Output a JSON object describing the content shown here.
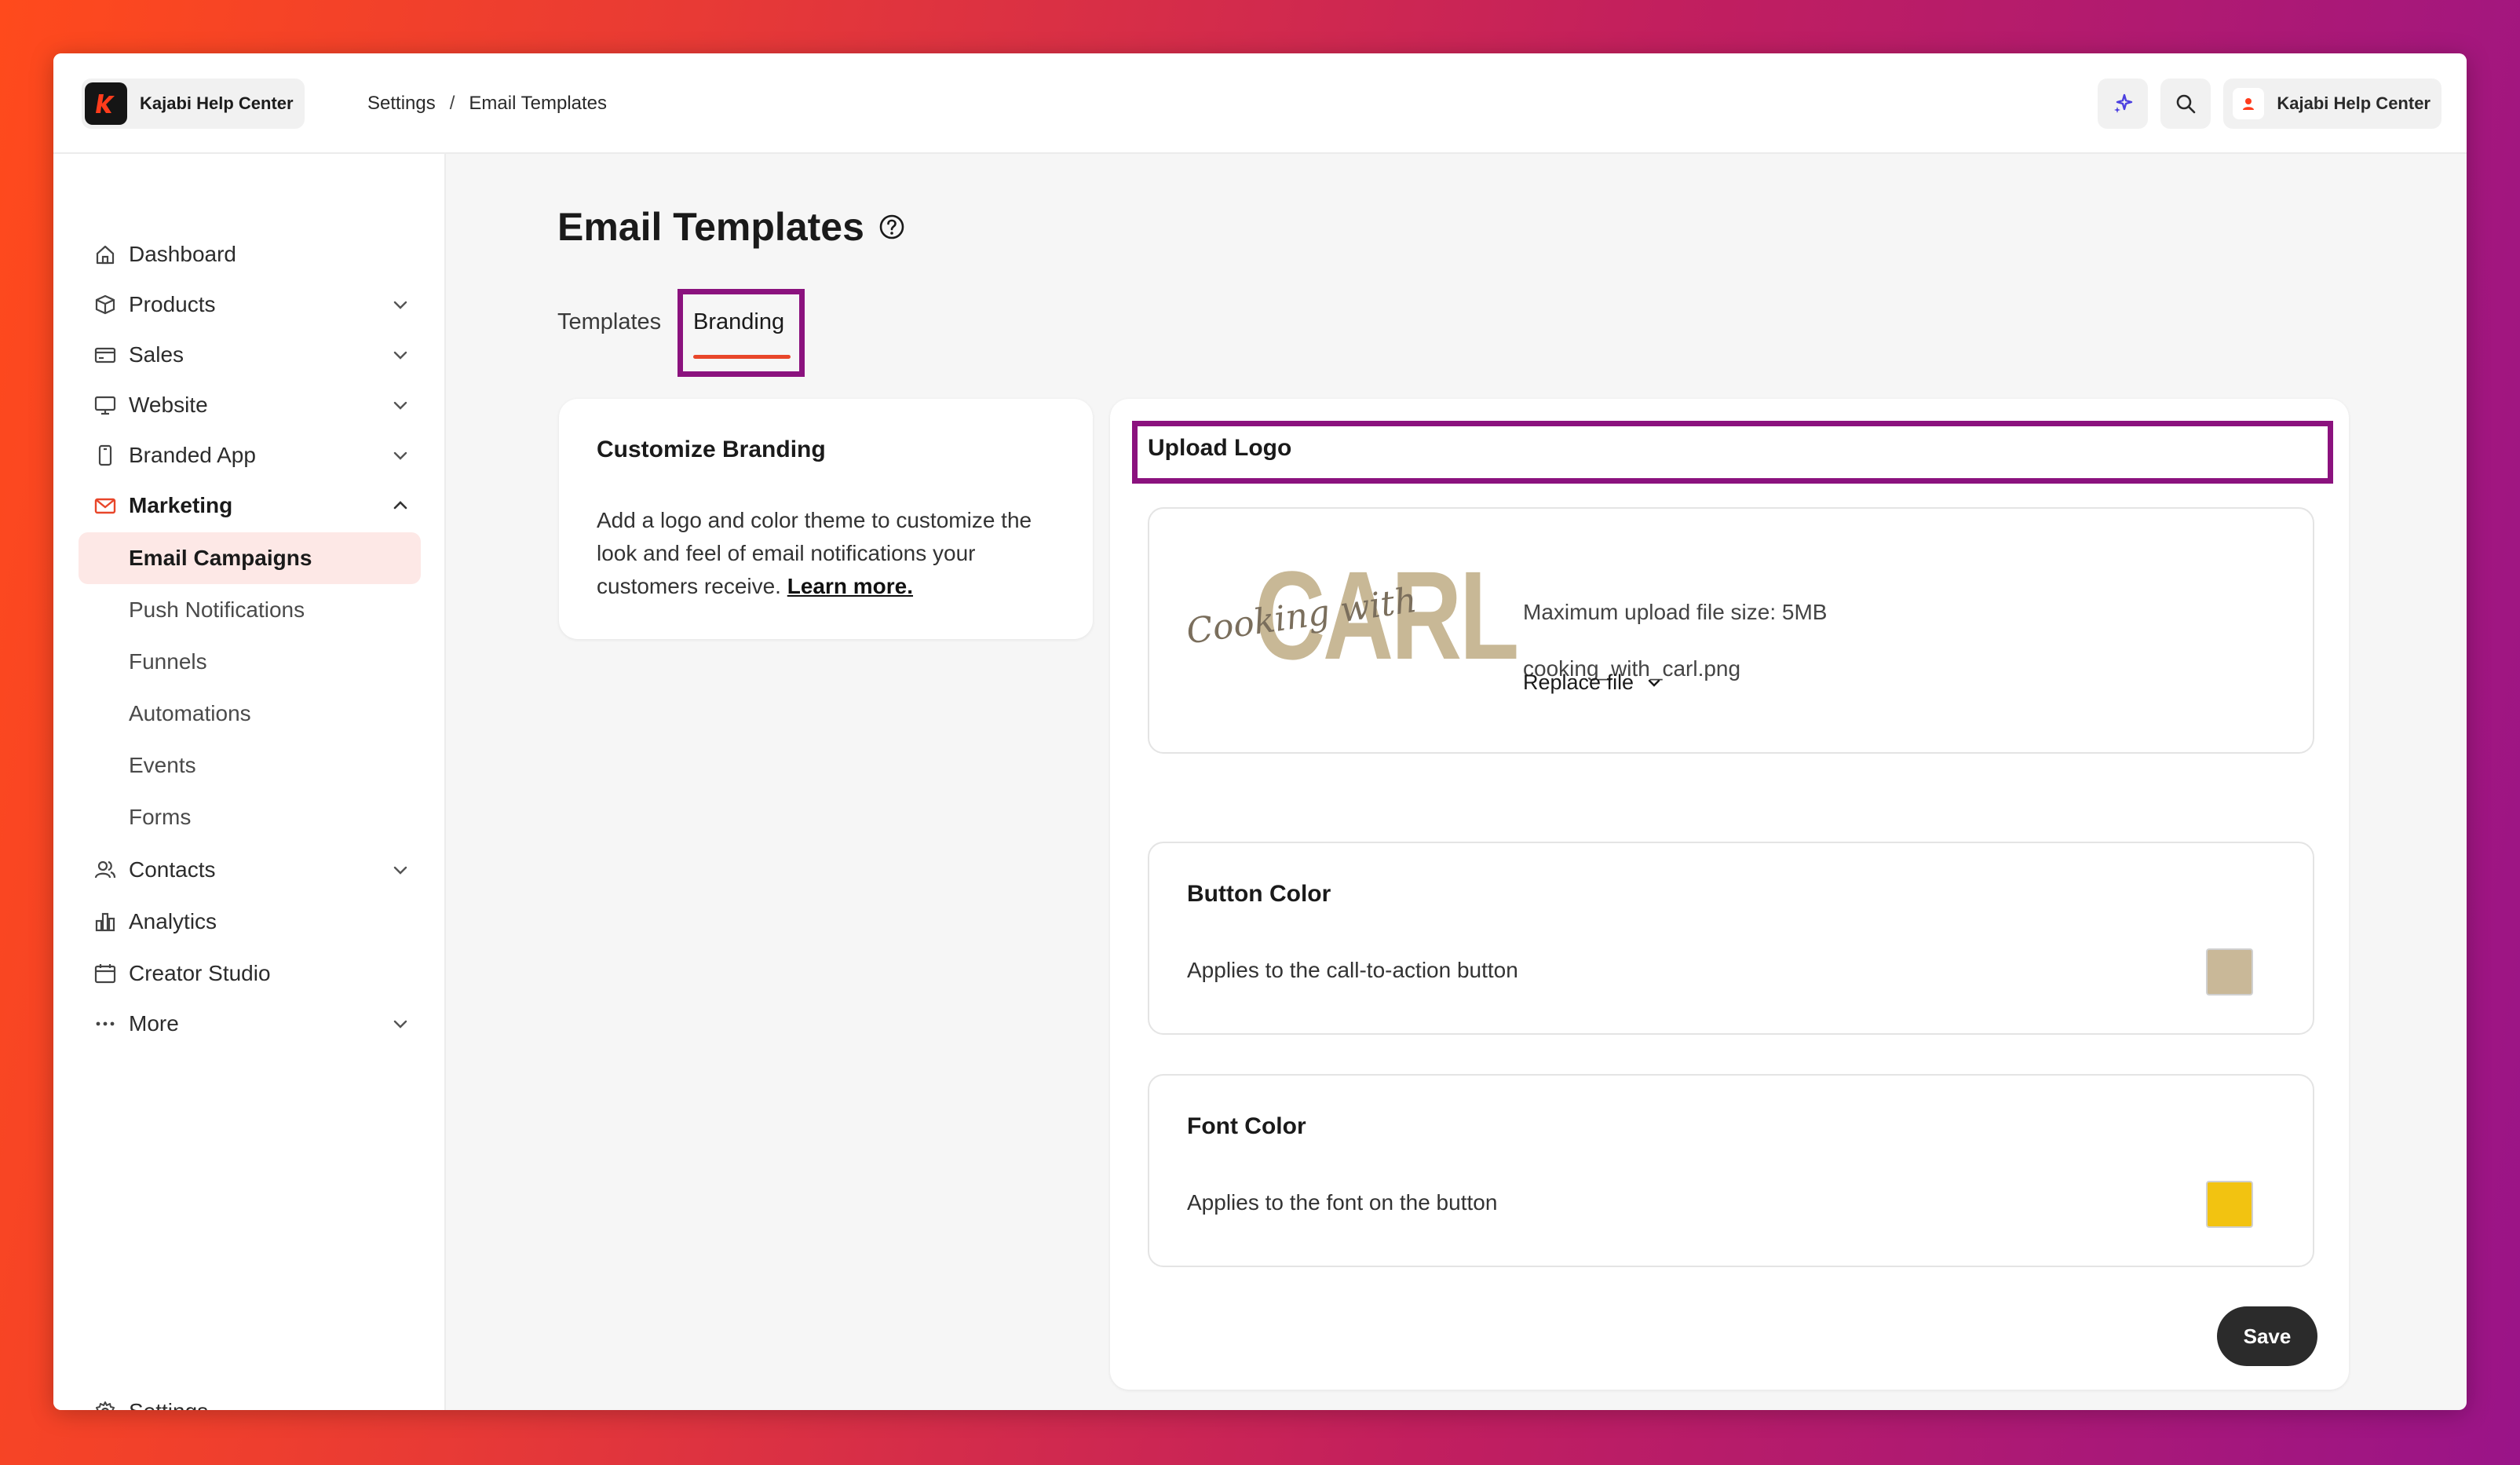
{
  "app": {
    "brand_name": "Kajabi Help Center",
    "user_label": "Kajabi Help Center"
  },
  "breadcrumb": {
    "parent": "Settings",
    "separator": "/",
    "current": "Email Templates"
  },
  "sidebar": {
    "items": [
      {
        "label": "Dashboard",
        "icon": "home-icon",
        "has_chevron": false
      },
      {
        "label": "Products",
        "icon": "box-icon",
        "has_chevron": true
      },
      {
        "label": "Sales",
        "icon": "credit-card-icon",
        "has_chevron": true
      },
      {
        "label": "Website",
        "icon": "monitor-icon",
        "has_chevron": true
      },
      {
        "label": "Branded App",
        "icon": "mobile-icon",
        "has_chevron": true
      },
      {
        "label": "Marketing",
        "icon": "mail-icon",
        "has_chevron": true,
        "expanded": true
      },
      {
        "label": "Contacts",
        "icon": "users-icon",
        "has_chevron": true
      },
      {
        "label": "Analytics",
        "icon": "bar-chart-icon",
        "has_chevron": false
      },
      {
        "label": "Creator Studio",
        "icon": "calendar-icon",
        "has_chevron": false
      },
      {
        "label": "More",
        "icon": "dots-icon",
        "has_chevron": true
      }
    ],
    "marketing_sub": [
      {
        "label": "Email Campaigns",
        "selected": true
      },
      {
        "label": "Push Notifications"
      },
      {
        "label": "Funnels"
      },
      {
        "label": "Automations"
      },
      {
        "label": "Events"
      },
      {
        "label": "Forms"
      }
    ],
    "settings_label": "Settings"
  },
  "main": {
    "title": "Email Templates",
    "tabs": [
      {
        "label": "Templates",
        "active": false
      },
      {
        "label": "Branding",
        "active": true
      }
    ],
    "customize": {
      "title": "Customize Branding",
      "description": "Add a logo and color theme to customize the look and feel of email notifications your customers receive.",
      "learn_more": "Learn more."
    },
    "upload": {
      "heading": "Upload Logo",
      "logo_text_script": "Cooking with",
      "logo_text_main": "CARL",
      "max_size": "Maximum upload file size: 5MB",
      "filename": "cooking_with_carl.png",
      "replace_label": "Replace file"
    },
    "button_color": {
      "title": "Button Color",
      "description": "Applies to the call-to-action button",
      "color": "#c9b898"
    },
    "font_color": {
      "title": "Font Color",
      "description": "Applies to the font on the button",
      "color": "#f2c311"
    },
    "save_label": "Save"
  },
  "colors": {
    "accent": "#e8462a",
    "highlight": "#8b127e",
    "selected_bg": "#fde8e6"
  }
}
